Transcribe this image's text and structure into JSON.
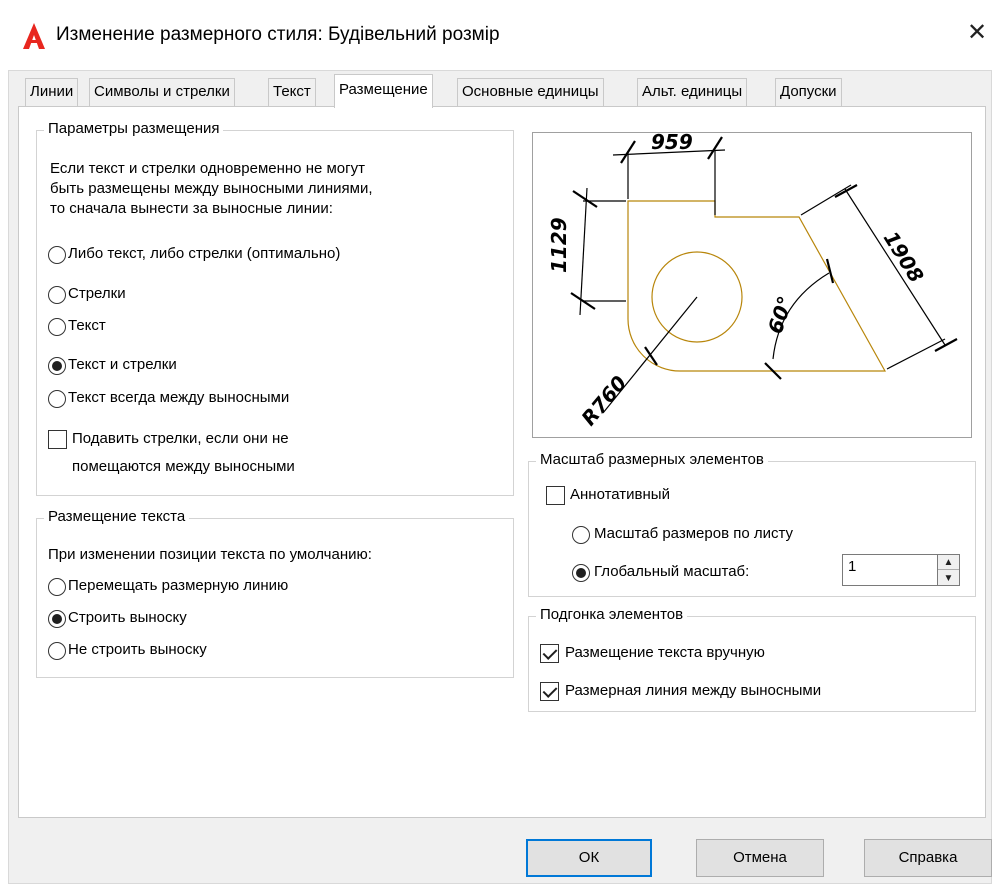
{
  "window": {
    "title": "Изменение размерного стиля: Будівельний розмір",
    "app_icon_letter": "A",
    "close_glyph": "✕"
  },
  "tabs": [
    {
      "label": "Линии",
      "active": false
    },
    {
      "label": "Символы и стрелки",
      "active": false
    },
    {
      "label": "Текст",
      "active": false
    },
    {
      "label": "Размещение",
      "active": true
    },
    {
      "label": "Основные единицы",
      "active": false
    },
    {
      "label": "Альт. единицы",
      "active": false
    },
    {
      "label": "Допуски",
      "active": false
    }
  ],
  "fit_options": {
    "legend": "Параметры размещения",
    "description": [
      "Если текст и стрелки одновременно не могут",
      "быть размещены между выносными линиями,",
      "то сначала вынести за выносные линии:"
    ],
    "radios": [
      {
        "label": "Либо текст, либо стрелки (оптимально)",
        "selected": false
      },
      {
        "label": "Стрелки",
        "selected": false
      },
      {
        "label": "Текст",
        "selected": false
      },
      {
        "label": "Текст и стрелки",
        "selected": true
      },
      {
        "label": "Текст всегда между выносными",
        "selected": false
      }
    ],
    "suppress_checkbox": {
      "line1": "Подавить стрелки, если они не",
      "line2": "помещаются между выносными",
      "checked": false
    }
  },
  "text_placement": {
    "legend": "Размещение текста",
    "description": "При изменении позиции текста по умолчанию:",
    "radios": [
      {
        "label": "Перемещать размерную линию",
        "selected": false
      },
      {
        "label": "Строить выноску",
        "selected": true
      },
      {
        "label": "Не строить выноску",
        "selected": false
      }
    ]
  },
  "preview": {
    "dim_top": "959",
    "dim_left": "1129",
    "dim_right": "1908",
    "dim_angle": "60°",
    "dim_radius": "R760",
    "shape_color": "#b8860b",
    "dim_color": "#000000"
  },
  "scale": {
    "legend": "Масштаб размерных элементов",
    "annotative": {
      "label": "Аннотативный",
      "checked": false
    },
    "radios": [
      {
        "label": "Масштаб размеров по листу",
        "selected": false
      },
      {
        "label": "Глобальный масштаб:",
        "selected": true
      }
    ],
    "global_scale_value": "1"
  },
  "fine_tuning": {
    "legend": "Подгонка элементов",
    "checkboxes": [
      {
        "label": "Размещение текста вручную",
        "checked": true
      },
      {
        "label": "Размерная линия между выносными",
        "checked": true
      }
    ]
  },
  "buttons": {
    "ok": "ОК",
    "cancel": "Отмена",
    "help": "Справка"
  },
  "colors": {
    "accent_focus": "#0078d7",
    "app_icon": "#e8261f"
  }
}
